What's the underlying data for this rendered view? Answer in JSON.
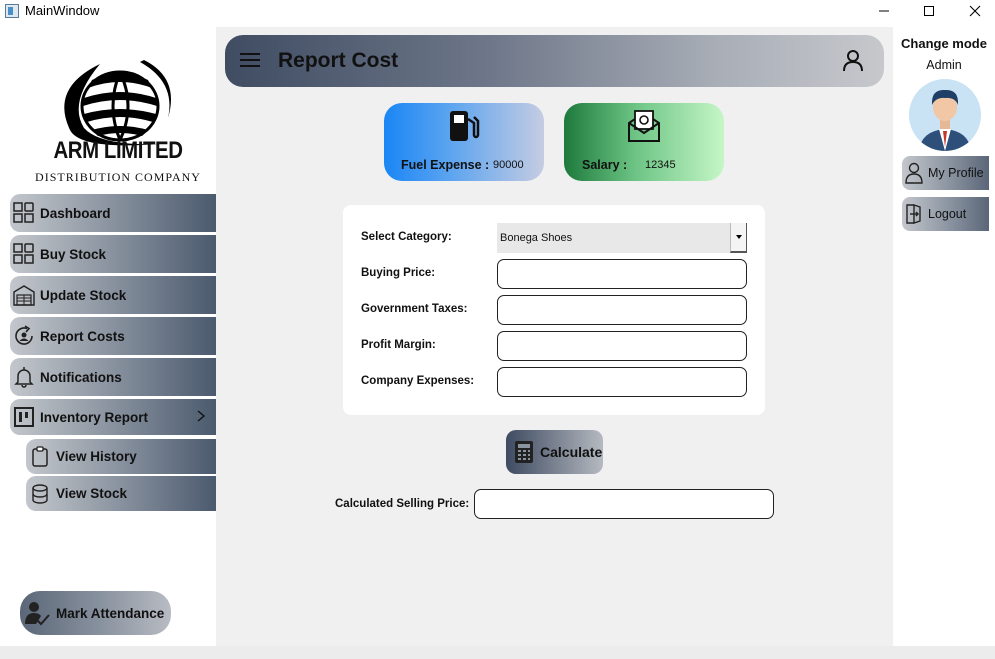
{
  "window": {
    "title": "MainWindow"
  },
  "sidebar": {
    "logo": {
      "title": "ARM LIMITED",
      "subtitle": "DISTRIBUTION COMPANY"
    },
    "items": [
      {
        "label": "Dashboard",
        "icon": "grid-icon"
      },
      {
        "label": "Buy Stock",
        "icon": "grid-icon"
      },
      {
        "label": "Update Stock",
        "icon": "warehouse-icon"
      },
      {
        "label": "Report Costs",
        "icon": "refresh-user-icon"
      },
      {
        "label": "Notifications",
        "icon": "bell-icon"
      },
      {
        "label": "Inventory Report",
        "icon": "kanban-icon"
      }
    ],
    "sub_items": [
      {
        "label": "View History",
        "icon": "clipboard-icon"
      },
      {
        "label": "View Stock",
        "icon": "database-icon"
      }
    ],
    "attendance_label": "Mark Attendance"
  },
  "header": {
    "title": "Report Cost"
  },
  "cards": {
    "fuel": {
      "label": "Fuel Expense :",
      "value": "90000"
    },
    "salary": {
      "label": "Salary :",
      "value": "12345"
    }
  },
  "form": {
    "category_label": "Select Category:",
    "category_value": "Bonega Shoes",
    "buying_price_label": "Buying Price:",
    "taxes_label": "Government Taxes:",
    "profit_margin_label": "Profit Margin:",
    "expenses_label": "Company Expenses:"
  },
  "calculate_label": "Calculate",
  "result": {
    "label": "Calculated Selling Price:"
  },
  "right_panel": {
    "mode_label": "Change mode",
    "role": "Admin",
    "profile_label": "My Profile",
    "logout_label": "Logout"
  }
}
